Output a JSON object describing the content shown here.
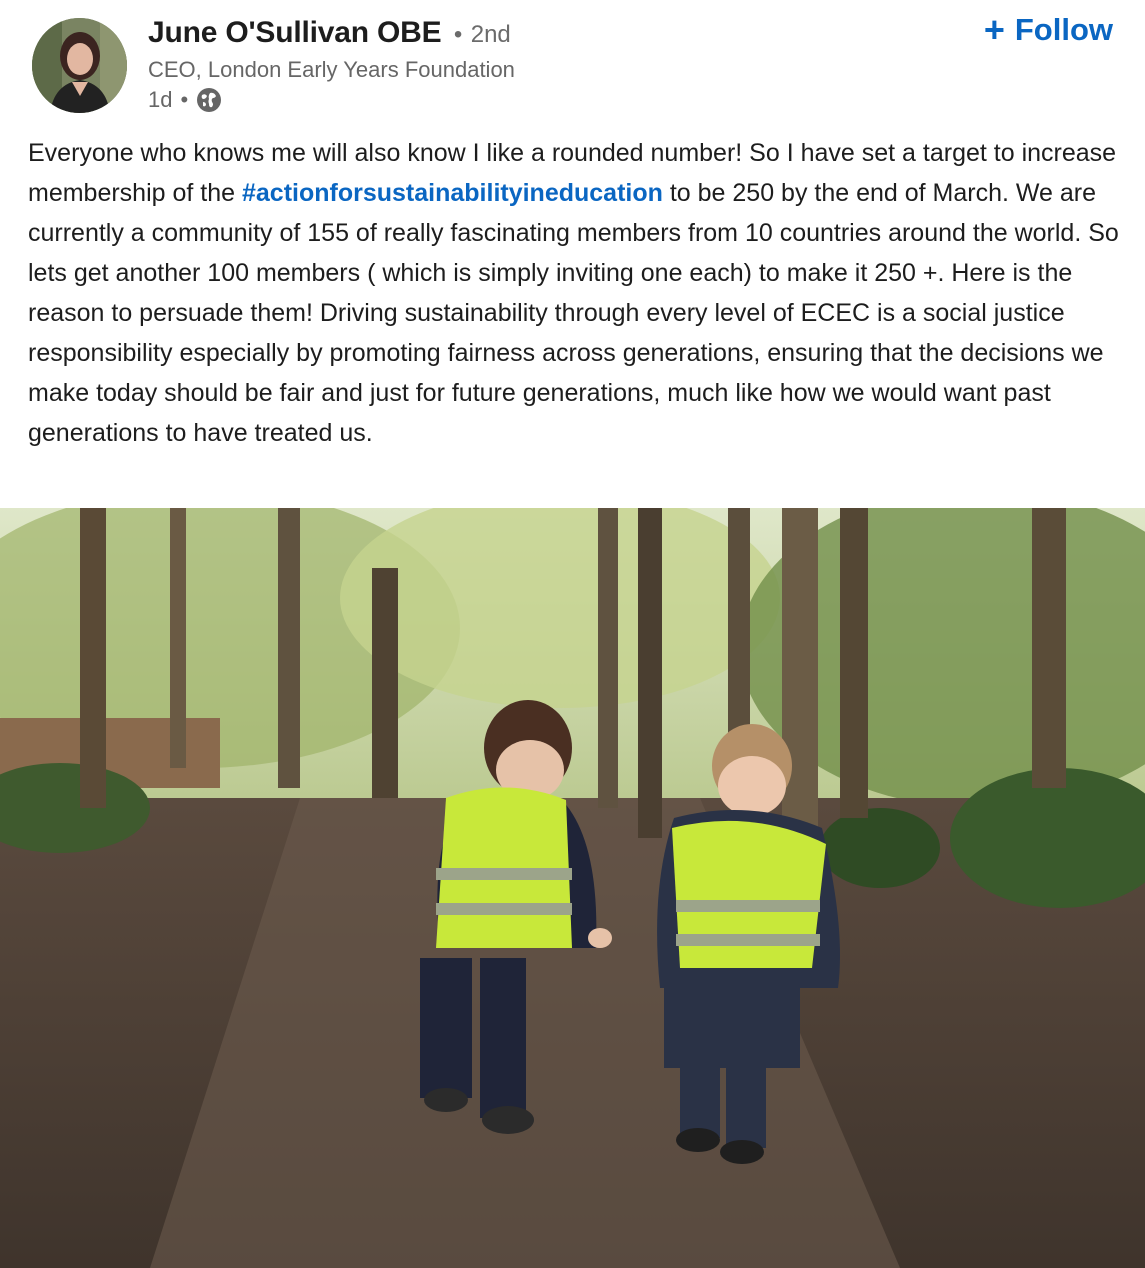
{
  "author": {
    "name": "June O'Sullivan OBE",
    "separator": "•",
    "degree": "2nd",
    "headline": "CEO, London Early Years Foundation",
    "time": "1d",
    "time_separator": "•",
    "visibility_icon": "globe-icon"
  },
  "follow": {
    "icon": "plus-icon",
    "plus": "+",
    "label": "Follow"
  },
  "post": {
    "text_before": "Everyone who knows me will also know I like a rounded number! So I have set a target to increase membership of the ",
    "hashtag": "#actionforsustainabilityineducation",
    "text_after": " to be 250 by the end of March. We are currently a community of 155 of really fascinating members from 10 countries around the world. So lets get another 100 members ( which is simply inviting one each) to make it 250 +. Here is the reason to persuade them! Driving sustainability through every level of ECEC is a social justice responsibility especially by promoting fairness across generations, ensuring that the decisions we make today should be fair and just for future generations, much like how we would want past generations to have treated us."
  },
  "colors": {
    "link": "#0a66c2",
    "text": "#1d1d1d",
    "muted": "#666666",
    "vest": "#c8e83a"
  }
}
